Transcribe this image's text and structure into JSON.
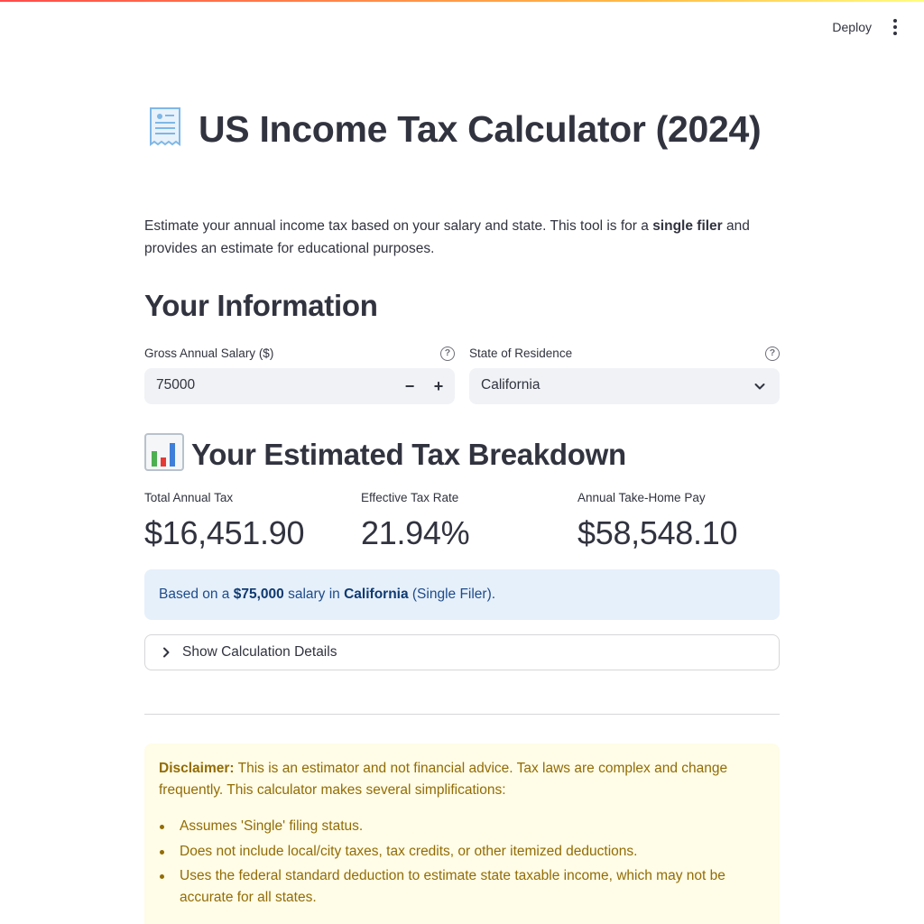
{
  "header": {
    "deploy_label": "Deploy",
    "menu_icon": "vertical-dots-icon"
  },
  "title": {
    "icon": "receipt-icon",
    "text": "US Income Tax Calculator (2024)"
  },
  "intro": {
    "part1": "Estimate your annual income tax based on your salary and state. This tool is for a ",
    "bold": "single filer",
    "part2": " and provides an estimate for educational purposes."
  },
  "info_section": {
    "heading": "Your Information",
    "salary": {
      "label": "Gross Annual Salary ($)",
      "value": "75000",
      "minus": "−",
      "plus": "+"
    },
    "state": {
      "label": "State of Residence",
      "value": "California"
    },
    "help_glyph": "?"
  },
  "breakdown": {
    "icon": "bar-chart-icon",
    "heading": "Your Estimated Tax Breakdown",
    "metrics": [
      {
        "label": "Total Annual Tax",
        "value": "$16,451.90"
      },
      {
        "label": "Effective Tax Rate",
        "value": "21.94%"
      },
      {
        "label": "Annual Take-Home Pay",
        "value": "$58,548.10"
      }
    ],
    "summary": {
      "prefix": "Based on a ",
      "salary": "$75,000",
      "mid": " salary in ",
      "state": "California",
      "suffix": " (Single Filer)."
    },
    "expander_label": "Show Calculation Details"
  },
  "disclaimer": {
    "bold": "Disclaimer:",
    "text": " This is an estimator and not financial advice. Tax laws are complex and change frequently. This calculator makes several simplifications:",
    "items": [
      "Assumes 'Single' filing status.",
      "Does not include local/city taxes, tax credits, or other itemized deductions.",
      "Uses the federal standard deduction to estimate state taxable income, which may not be accurate for all states."
    ]
  },
  "colors": {
    "accent_gradient_start": "#ff4b4b",
    "accent_gradient_end": "#fffd80",
    "info_bg": "#e6f0fb",
    "warning_bg": "#fffce7",
    "warning_text": "#926c05"
  }
}
